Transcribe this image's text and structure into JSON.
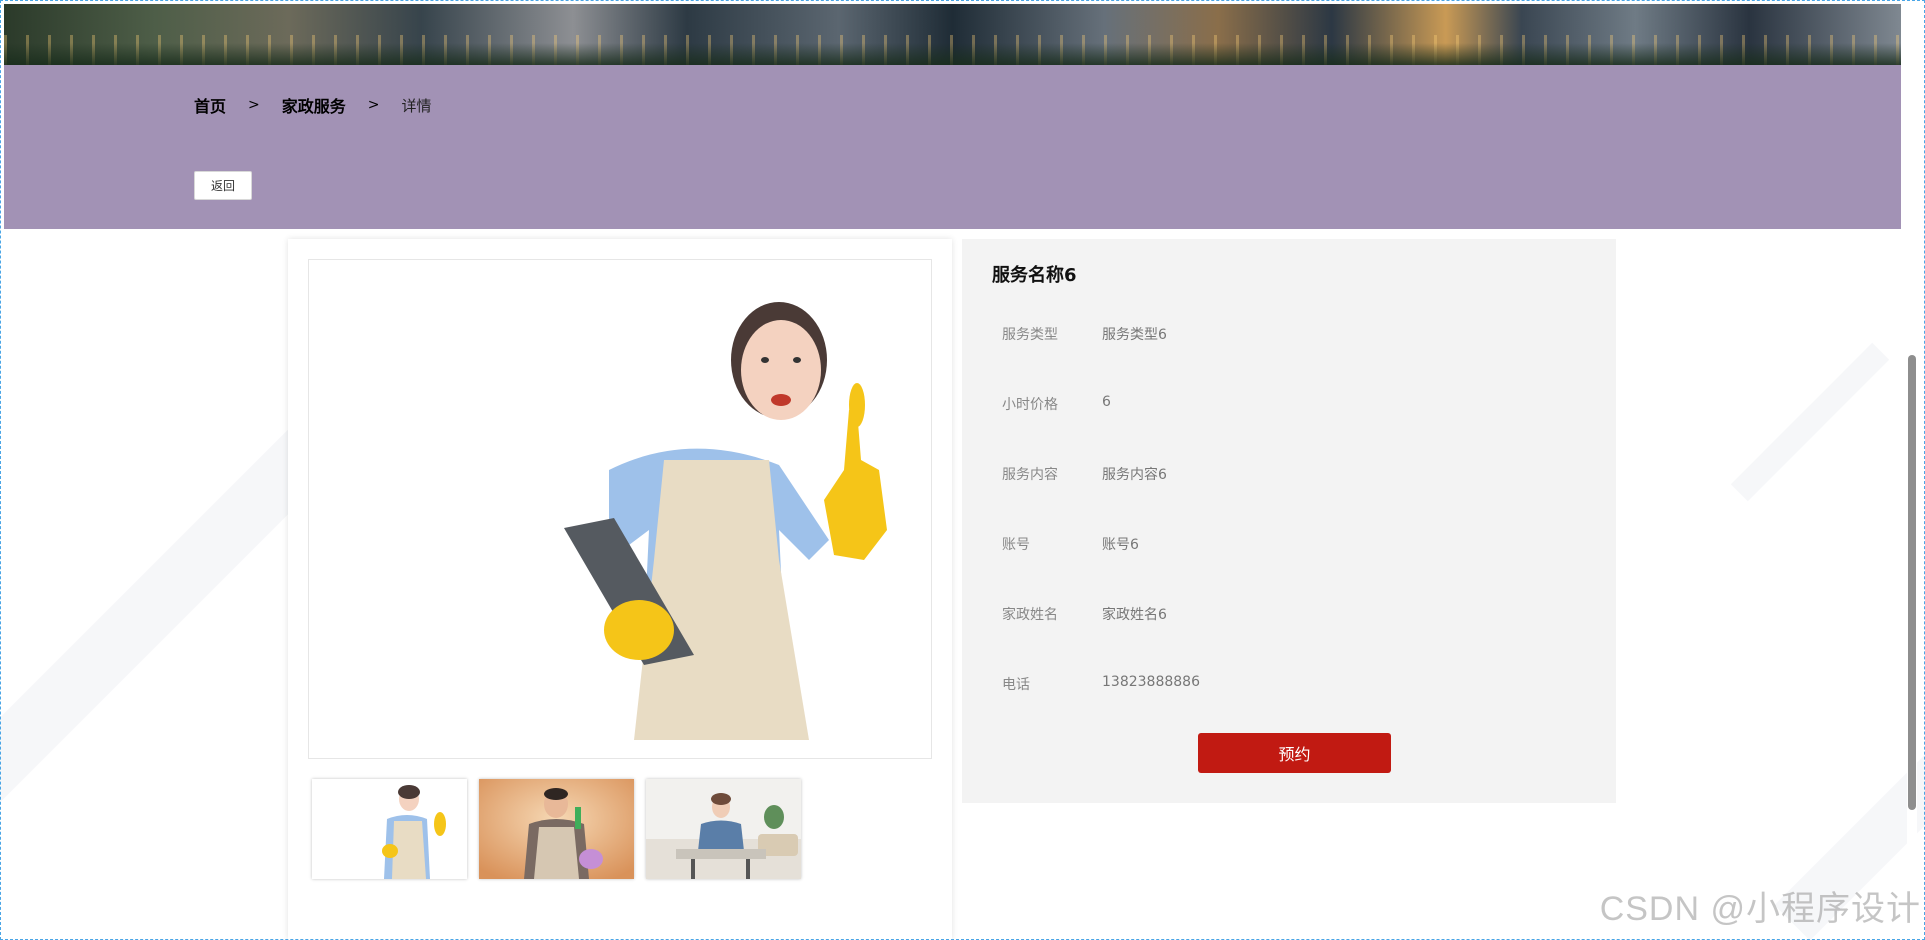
{
  "breadcrumb": {
    "home": "首页",
    "separator": ">",
    "section": "家政服务",
    "current": "详情"
  },
  "back_button": "返回",
  "service": {
    "title": "服务名称6",
    "fields": [
      {
        "label": "服务类型",
        "value": "服务类型6"
      },
      {
        "label": "小时价格",
        "value": "6"
      },
      {
        "label": "服务内容",
        "value": "服务内容6"
      },
      {
        "label": "账号",
        "value": "账号6"
      },
      {
        "label": "家政姓名",
        "value": "家政姓名6"
      },
      {
        "label": "电话",
        "value": "13823888886"
      }
    ],
    "book_label": "预约"
  },
  "gallery": {
    "thumbnails": [
      "thumbnail-1",
      "thumbnail-2",
      "thumbnail-3"
    ]
  },
  "colors": {
    "hero": "#a292b5",
    "accent": "#c11a12",
    "panel": "#f3f3f3"
  },
  "watermark": "CSDN @小程序设计"
}
